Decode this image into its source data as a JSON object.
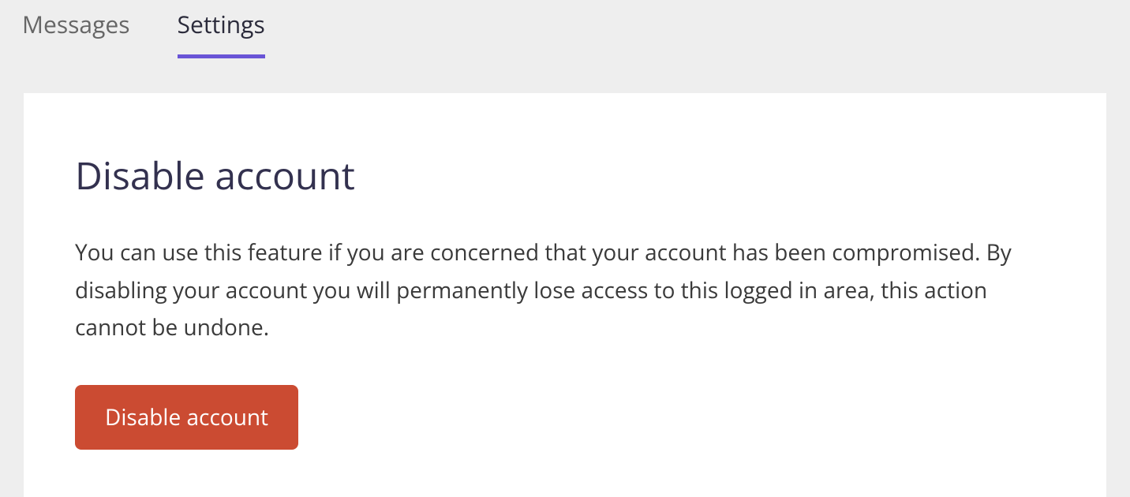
{
  "tabs": {
    "messages": {
      "label": "Messages"
    },
    "settings": {
      "label": "Settings"
    }
  },
  "card": {
    "title": "Disable account",
    "description": "You can use this feature if you are concerned that your account has been compromised. By disabling your account you will permanently lose access to this logged in area, this action cannot be undone.",
    "button_label": "Disable account"
  }
}
